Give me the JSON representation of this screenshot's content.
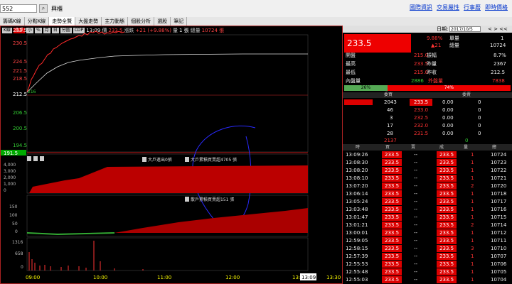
{
  "topbar": {
    "code": "552",
    "stock_name": "興櫃",
    "links": [
      "國際資訊",
      "交易屬性",
      "行事曆",
      "即時價格"
    ]
  },
  "tabs": [
    {
      "label": "籌碼K線"
    },
    {
      "label": "分點K線"
    },
    {
      "label": "走勢全覽"
    },
    {
      "label": "大盤走勢"
    },
    {
      "label": "主力動態"
    },
    {
      "label": "個股分析"
    },
    {
      "label": "選股"
    },
    {
      "label": "筆記"
    }
  ],
  "toolbar": {
    "buttons": [
      "K線",
      "大戶",
      "小",
      "%",
      "月",
      "日",
      "分圖",
      "CDP"
    ],
    "time": "13:09",
    "price_label": "價",
    "price": "233.5",
    "change_label": "漲跌",
    "change": "+21 (+9.88%)",
    "volume_label": "量",
    "volume": "1 張",
    "total_label": "總量",
    "total": "10724 張"
  },
  "price_axis": [
    "233.5",
    "230.5",
    "224.5",
    "221.5",
    "218.5",
    "212.5",
    "206.5",
    "200.5",
    "194.5",
    "191.5"
  ],
  "low_marker": "216",
  "panel_labels": {
    "big_in": "大戶進出0張",
    "big_cum": "大戶累積買賣超4705 張",
    "retail_cum": "散戶累積買賣超151 張"
  },
  "big_axis": [
    "4,000",
    "3,000",
    "2,000",
    "1,000",
    "0"
  ],
  "retail_axis": [
    "150",
    "100",
    "50",
    "0",
    "-50"
  ],
  "vol_axis": [
    "1316",
    "658",
    "0"
  ],
  "time_axis": [
    "09:00",
    "10:00",
    "11:00",
    "12:00",
    "13:",
    "13:30"
  ],
  "time_cursor": "13:09",
  "right_panel": {
    "date_label": "日期:",
    "date": "2017/10/5",
    "last_price": "233.5",
    "pct": "9.88%",
    "chg": "▲21",
    "single_label": "單量",
    "single": "1",
    "total_label": "總量",
    "total": "10724",
    "stats": [
      {
        "label": "開盤",
        "value": "215.0",
        "label2": "振幅",
        "value2": "8.7%"
      },
      {
        "label": "最高",
        "value": "233.5",
        "label2": "昨量",
        "value2": "2367"
      },
      {
        "label": "最低",
        "value": "215.0",
        "label2": "昨收",
        "value2": "212.5"
      },
      {
        "label": "內盤量",
        "value": "2886",
        "label2": "外盤量",
        "value2": "7838"
      }
    ],
    "inout_pct": {
      "in": "26%",
      "out": "74%"
    },
    "bid_header": "委買",
    "ask_header": "委賣",
    "bids": [
      {
        "qty": "2043",
        "price": "233.5",
        "ask": "0.00",
        "askqty": "0"
      },
      {
        "qty": "46",
        "price": "233.0",
        "ask": "0.00",
        "askqty": "0"
      },
      {
        "qty": "3",
        "price": "232.5",
        "ask": "0.00",
        "askqty": "0"
      },
      {
        "qty": "17",
        "price": "232.0",
        "ask": "0.00",
        "askqty": "0"
      },
      {
        "qty": "28",
        "price": "231.5",
        "ask": "0.00",
        "askqty": "0"
      }
    ],
    "bid_total": "2137",
    "ask_total": "0",
    "tick_headers": [
      "時",
      "買",
      "賣",
      "成",
      "量",
      "總"
    ],
    "ticks": [
      {
        "t": "13:09:26",
        "b": "233.5",
        "s": "--",
        "p": "233.5",
        "v": "1",
        "tot": "10724"
      },
      {
        "t": "13:08:30",
        "b": "233.5",
        "s": "--",
        "p": "233.5",
        "v": "1",
        "tot": "10723"
      },
      {
        "t": "13:08:20",
        "b": "233.5",
        "s": "--",
        "p": "233.5",
        "v": "1",
        "tot": "10722"
      },
      {
        "t": "13:08:10",
        "b": "233.5",
        "s": "--",
        "p": "233.5",
        "v": "1",
        "tot": "10721"
      },
      {
        "t": "13:07:20",
        "b": "233.5",
        "s": "--",
        "p": "233.5",
        "v": "2",
        "tot": "10720"
      },
      {
        "t": "13:06:14",
        "b": "233.5",
        "s": "--",
        "p": "233.5",
        "v": "1",
        "tot": "10718"
      },
      {
        "t": "13:05:24",
        "b": "233.5",
        "s": "--",
        "p": "233.5",
        "v": "1",
        "tot": "10717"
      },
      {
        "t": "13:03:48",
        "b": "233.5",
        "s": "--",
        "p": "233.5",
        "v": "1",
        "tot": "10716"
      },
      {
        "t": "13:01:47",
        "b": "233.5",
        "s": "--",
        "p": "233.5",
        "v": "1",
        "tot": "10715"
      },
      {
        "t": "13:01:21",
        "b": "233.5",
        "s": "--",
        "p": "233.5",
        "v": "2",
        "tot": "10714"
      },
      {
        "t": "13:00:01",
        "b": "233.5",
        "s": "--",
        "p": "233.5",
        "v": "1",
        "tot": "10712"
      },
      {
        "t": "12:59:05",
        "b": "233.5",
        "s": "--",
        "p": "233.5",
        "v": "1",
        "tot": "10711"
      },
      {
        "t": "12:58:15",
        "b": "233.5",
        "s": "--",
        "p": "233.5",
        "v": "3",
        "tot": "10710"
      },
      {
        "t": "12:57:39",
        "b": "233.5",
        "s": "--",
        "p": "233.5",
        "v": "1",
        "tot": "10707"
      },
      {
        "t": "12:55:53",
        "b": "233.5",
        "s": "--",
        "p": "233.5",
        "v": "1",
        "tot": "10706"
      },
      {
        "t": "12:55:48",
        "b": "233.5",
        "s": "--",
        "p": "233.5",
        "v": "1",
        "tot": "10705"
      },
      {
        "t": "12:55:03",
        "b": "233.5",
        "s": "--",
        "p": "233.5",
        "v": "1",
        "tot": "10704"
      }
    ]
  }
}
